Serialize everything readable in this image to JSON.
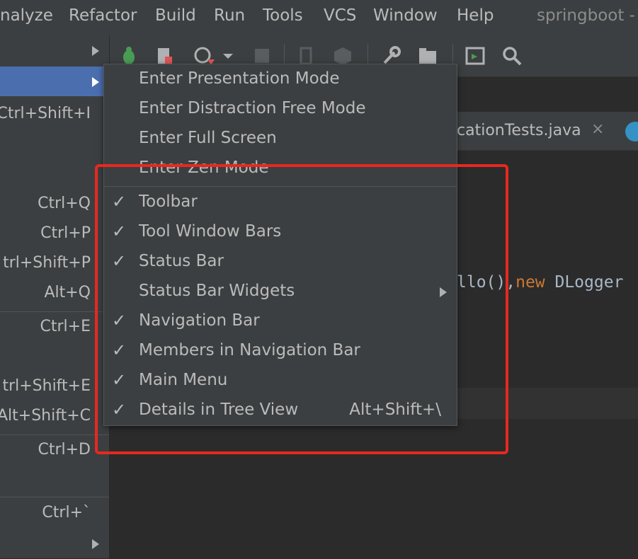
{
  "menubar": {
    "items": [
      "nalyze",
      "Refactor",
      "Build",
      "Run",
      "Tools",
      "VCS",
      "Window",
      "Help"
    ],
    "title": "springboot -"
  },
  "leftmenu": {
    "shortcuts": [
      "Ctrl+Shift+I",
      "Ctrl+Q",
      "Ctrl+P",
      "trl+Shift+P",
      "Alt+Q",
      "Ctrl+E",
      "trl+Shift+E",
      "Alt+Shift+C",
      "Ctrl+D",
      "Ctrl+`"
    ]
  },
  "tab": {
    "label": "cationTests.java",
    "close": "×"
  },
  "editor": {
    "code_pre": "llo(),",
    "code_kw": "new",
    "code_post": " DLogger"
  },
  "popup": {
    "items": [
      {
        "label": "Enter Presentation Mode",
        "checked": false
      },
      {
        "label": "Enter Distraction Free Mode",
        "checked": false
      },
      {
        "label": "Enter Full Screen",
        "checked": false
      },
      {
        "label": "Enter Zen Mode",
        "checked": false
      },
      {
        "label": "Toolbar",
        "checked": true
      },
      {
        "label": "Tool Window Bars",
        "checked": true
      },
      {
        "label": "Status Bar",
        "checked": true
      },
      {
        "label": "Status Bar Widgets",
        "checked": false,
        "submenu": true
      },
      {
        "label": "Navigation Bar",
        "checked": true
      },
      {
        "label": "Members in Navigation Bar",
        "checked": true
      },
      {
        "label": "Main Menu",
        "checked": true
      },
      {
        "label": "Details in Tree View",
        "checked": true,
        "shortcut": "Alt+Shift+\\"
      }
    ],
    "check_glyph": "✓"
  },
  "colors": {
    "highlight": "#4b6eaf",
    "annotation": "#e8281f",
    "keyword": "#cc7832"
  }
}
